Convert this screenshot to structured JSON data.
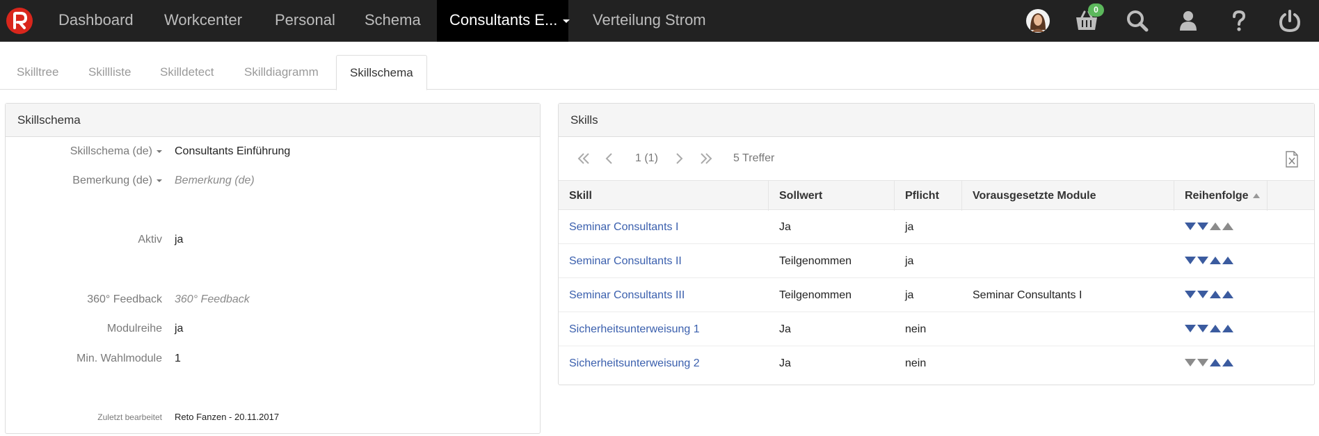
{
  "navbar": {
    "items": [
      {
        "label": "Dashboard"
      },
      {
        "label": "Workcenter"
      },
      {
        "label": "Personal"
      },
      {
        "label": "Schema"
      },
      {
        "label": "Consultants E..."
      },
      {
        "label": "Verteilung Strom"
      }
    ],
    "active_index": 4,
    "cart_count": "0",
    "icons": [
      "avatar",
      "cart-icon",
      "search-icon",
      "user-icon",
      "help-icon",
      "power-icon"
    ],
    "colors": {
      "bar": "#222222",
      "active": "#000000",
      "badge": "#5cb85c",
      "logo": "#d9261c"
    }
  },
  "tabs": {
    "items": [
      {
        "label": "Skilltree"
      },
      {
        "label": "Skillliste"
      },
      {
        "label": "Skilldetect"
      },
      {
        "label": "Skilldiagramm"
      },
      {
        "label": "Skillschema"
      }
    ],
    "active_index": 4
  },
  "left_panel": {
    "title": "Skillschema",
    "fields": {
      "schema": {
        "label": "Skillschema (de)",
        "value": "Consultants Einführung"
      },
      "remark": {
        "label": "Bemerkung (de)",
        "placeholder": "Bemerkung (de)"
      },
      "active": {
        "label": "Aktiv",
        "value": "ja"
      },
      "feedback": {
        "label": "360° Feedback",
        "placeholder": "360° Feedback"
      },
      "modulreihe": {
        "label": "Modulreihe",
        "value": "ja"
      },
      "min_wahl": {
        "label": "Min. Wahlmodule",
        "value": "1"
      },
      "last_edited": {
        "label": "Zuletzt bearbeitet",
        "value": "Reto Fanzen - 20.11.2017"
      }
    }
  },
  "right_panel": {
    "title": "Skills",
    "pager": {
      "page": "1 (1)",
      "hits": "5 Treffer"
    },
    "columns": {
      "skill": "Skill",
      "sollwert": "Sollwert",
      "pflicht": "Pflicht",
      "module": "Vorausgesetzte Module",
      "order": "Reihenfolge"
    },
    "rows": [
      {
        "skill": "Seminar Consultants I",
        "sollwert": "Ja",
        "pflicht": "ja",
        "module": "",
        "order": {
          "down": true,
          "up": false
        }
      },
      {
        "skill": "Seminar Consultants II",
        "sollwert": "Teilgenommen",
        "pflicht": "ja",
        "module": "",
        "order": {
          "down": true,
          "up": true
        }
      },
      {
        "skill": "Seminar Consultants III",
        "sollwert": "Teilgenommen",
        "pflicht": "ja",
        "module": "Seminar Consultants I",
        "order": {
          "down": true,
          "up": true
        }
      },
      {
        "skill": "Sicherheitsunterweisung 1",
        "sollwert": "Ja",
        "pflicht": "nein",
        "module": "",
        "order": {
          "down": true,
          "up": true
        }
      },
      {
        "skill": "Sicherheitsunterweisung 2",
        "sollwert": "Ja",
        "pflicht": "nein",
        "module": "",
        "order": {
          "down": false,
          "up": true
        }
      }
    ],
    "colors": {
      "link": "#3a5fad",
      "order_enabled": "#3b5b9f",
      "order_disabled": "#8b8b8b"
    }
  }
}
